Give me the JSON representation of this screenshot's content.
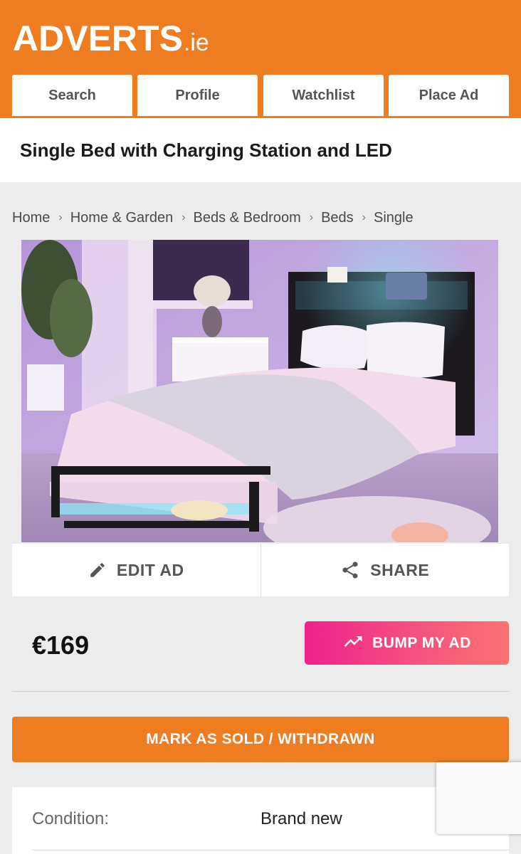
{
  "header": {
    "logo_main": "ADVERTS",
    "logo_tld": ".ie",
    "tabs": [
      {
        "label": "Search"
      },
      {
        "label": "Profile"
      },
      {
        "label": "Watchlist"
      },
      {
        "label": "Place Ad"
      }
    ]
  },
  "ad": {
    "title": "Single Bed with Charging Station and LED",
    "price": "€169",
    "condition_label": "Condition:",
    "condition_value": "Brand new"
  },
  "breadcrumb": [
    "Home",
    "Home & Garden",
    "Beds & Bedroom",
    "Beds",
    "Single"
  ],
  "actions": {
    "edit_label": "EDIT AD",
    "share_label": "SHARE",
    "bump_label": "BUMP MY AD",
    "sold_label": "MARK AS SOLD / WITHDRAWN"
  },
  "colors": {
    "brand_orange": "#ee7d22",
    "bump_gradient_start": "#f0228d",
    "bump_gradient_end": "#fb7272"
  },
  "icons": [
    "pencil-icon",
    "share-icon",
    "trending-up-icon",
    "breadcrumb-chevron-icon"
  ]
}
